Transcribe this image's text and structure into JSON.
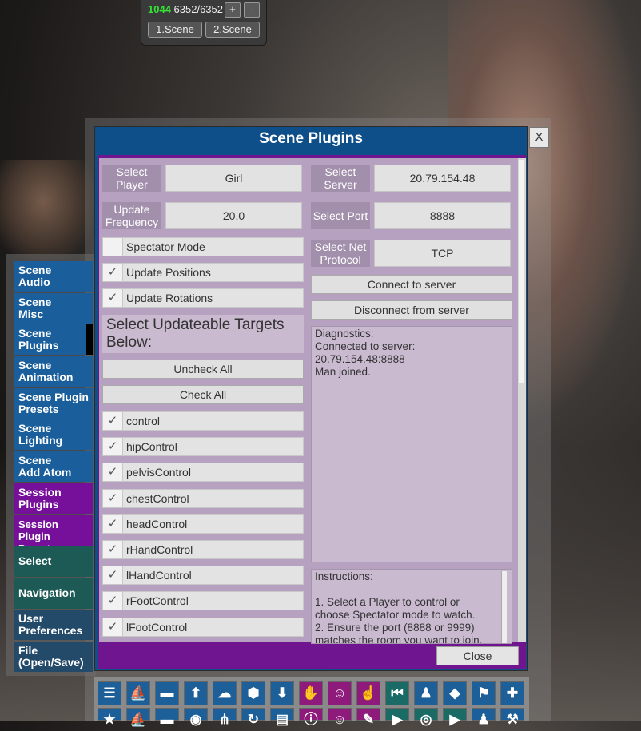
{
  "hud": {
    "fps": "1044",
    "counts": "6352/6352",
    "plus_label": "+",
    "minus_label": "-",
    "scene1_label": "1.Scene",
    "scene2_label": "2.Scene"
  },
  "nav": {
    "items": [
      {
        "line1": "Scene",
        "line2": "Audio"
      },
      {
        "line1": "Scene",
        "line2": "Misc"
      },
      {
        "line1": "Scene",
        "line2": "Plugins"
      },
      {
        "line1": "Scene",
        "line2": "Animation"
      },
      {
        "line1": "Scene Plugin",
        "line2": "Presets"
      },
      {
        "line1": "Scene",
        "line2": "Lighting"
      },
      {
        "line1": "Scene",
        "line2": "Add Atom"
      },
      {
        "line1": "Session",
        "line2": "Plugins"
      },
      {
        "line1": "Session Plugin",
        "line2": "Presets"
      },
      {
        "line1": "Select",
        "line2": ""
      },
      {
        "line1": "Navigation",
        "line2": ""
      },
      {
        "line1": "User",
        "line2": "Preferences"
      },
      {
        "line1": "File",
        "line2": "(Open/Save)"
      }
    ],
    "colors": {
      "scene": "#1a5f9c",
      "session": "#76109a",
      "select": "#1d5a55",
      "user": "#244a6a"
    }
  },
  "dialog": {
    "title": "Scene Plugins",
    "close_x": "X",
    "close_label": "Close",
    "colors": {
      "frame": "#0e4f8a",
      "inner": "#6f1590",
      "content": "#b6a2c0"
    }
  },
  "left": {
    "select_player_label": [
      "Select",
      "Player"
    ],
    "select_player_value": "Girl",
    "update_freq_label": [
      "Update",
      "Frequency"
    ],
    "update_freq_value": "20.0",
    "spectator_label": "Spectator Mode",
    "spectator_checked": false,
    "update_positions_label": "Update Positions",
    "update_positions_checked": true,
    "update_rotations_label": "Update Rotations",
    "update_rotations_checked": true,
    "targets_header": [
      "Select Updateable Targets",
      "Below:"
    ],
    "uncheck_all_label": "Uncheck All",
    "check_all_label": "Check All",
    "targets": [
      "control",
      "hipControl",
      "pelvisControl",
      "chestControl",
      "headControl",
      "rHandControl",
      "lHandControl",
      "rFootControl",
      "lFootControl"
    ],
    "check_mark": "✓"
  },
  "right": {
    "select_server_label": [
      "Select",
      "Server"
    ],
    "select_server_value": "20.79.154.48",
    "select_port_label": "Select Port",
    "select_port_value": "8888",
    "protocol_label": [
      "Select Net",
      "Protocol"
    ],
    "protocol_value": "TCP",
    "connect_label": "Connect to server",
    "disconnect_label": "Disconnect from server",
    "diagnostics": [
      "Diagnostics:",
      "Connected to server:",
      "20.79.154.48:8888",
      "Man joined."
    ],
    "instructions": [
      "Instructions:",
      "",
      "1. Select a Player to control or",
      "choose Spectator mode to watch.",
      "2. Ensure the port (8888 or 9999)",
      "matches the room you want to join."
    ]
  },
  "toolbar": {
    "row1": [
      {
        "name": "menu-icon",
        "glyph": "☰",
        "bg": "#1d5f98"
      },
      {
        "name": "scene-green-icon",
        "glyph": "⛵",
        "bg": "#1d5f98"
      },
      {
        "name": "folder-open-icon",
        "glyph": "▬",
        "bg": "#1d5f98"
      },
      {
        "name": "scene-red-icon",
        "glyph": "⬆",
        "bg": "#1d5f98"
      },
      {
        "name": "cloud-download-icon",
        "glyph": "☁",
        "bg": "#1d5f98"
      },
      {
        "name": "cube-icon",
        "glyph": "⬢",
        "bg": "#1d5f98"
      },
      {
        "name": "inbox-download-icon",
        "glyph": "⬇",
        "bg": "#1d5f98"
      },
      {
        "name": "hand-icon",
        "glyph": "✋",
        "bg": "#8e1a7c"
      },
      {
        "name": "person-add-icon",
        "glyph": "☺",
        "bg": "#8e1a7c"
      },
      {
        "name": "hand-pointer-icon",
        "glyph": "☝",
        "bg": "#8e1a7c"
      },
      {
        "name": "skip-back-icon",
        "glyph": "⏮",
        "bg": "#1a6a66"
      },
      {
        "name": "person-icon",
        "glyph": "♟",
        "bg": "#1d5f98"
      },
      {
        "name": "unity-icon",
        "glyph": "◆",
        "bg": "#1d5f98"
      },
      {
        "name": "flag-icon",
        "glyph": "⚑",
        "bg": "#1d5f98"
      },
      {
        "name": "plus-icon",
        "glyph": "✚",
        "bg": "#1d5f98"
      }
    ],
    "row2": [
      {
        "name": "star-icon",
        "glyph": "★",
        "bg": "#1d5f98"
      },
      {
        "name": "scene-alt-icon",
        "glyph": "⛵",
        "bg": "#1d5f98"
      },
      {
        "name": "folder-alt-icon",
        "glyph": "▬",
        "bg": "#1d5f98"
      },
      {
        "name": "camera-icon",
        "glyph": "◉",
        "bg": "#1d5f98"
      },
      {
        "name": "branch-icon",
        "glyph": "⋔",
        "bg": "#1d5f98"
      },
      {
        "name": "refresh-icon",
        "glyph": "↻",
        "bg": "#1d5f98"
      },
      {
        "name": "document-icon",
        "glyph": "▤",
        "bg": "#1d5f98"
      },
      {
        "name": "info-icon",
        "glyph": "ⓘ",
        "bg": "#8e1a7c"
      },
      {
        "name": "person-alt-icon",
        "glyph": "☺",
        "bg": "#8e1a7c"
      },
      {
        "name": "tag-icon",
        "glyph": "✎",
        "bg": "#8e1a7c"
      },
      {
        "name": "play-icon",
        "glyph": "▶",
        "bg": "#1a6a66"
      },
      {
        "name": "compass-icon",
        "glyph": "◎",
        "bg": "#1a6a66"
      },
      {
        "name": "play-alt-icon",
        "glyph": "▶",
        "bg": "#1a6a66"
      },
      {
        "name": "person-network-icon",
        "glyph": "♟",
        "bg": "#1d5f98"
      },
      {
        "name": "tools-icon",
        "glyph": "⚒",
        "bg": "#1d5f98"
      }
    ]
  }
}
